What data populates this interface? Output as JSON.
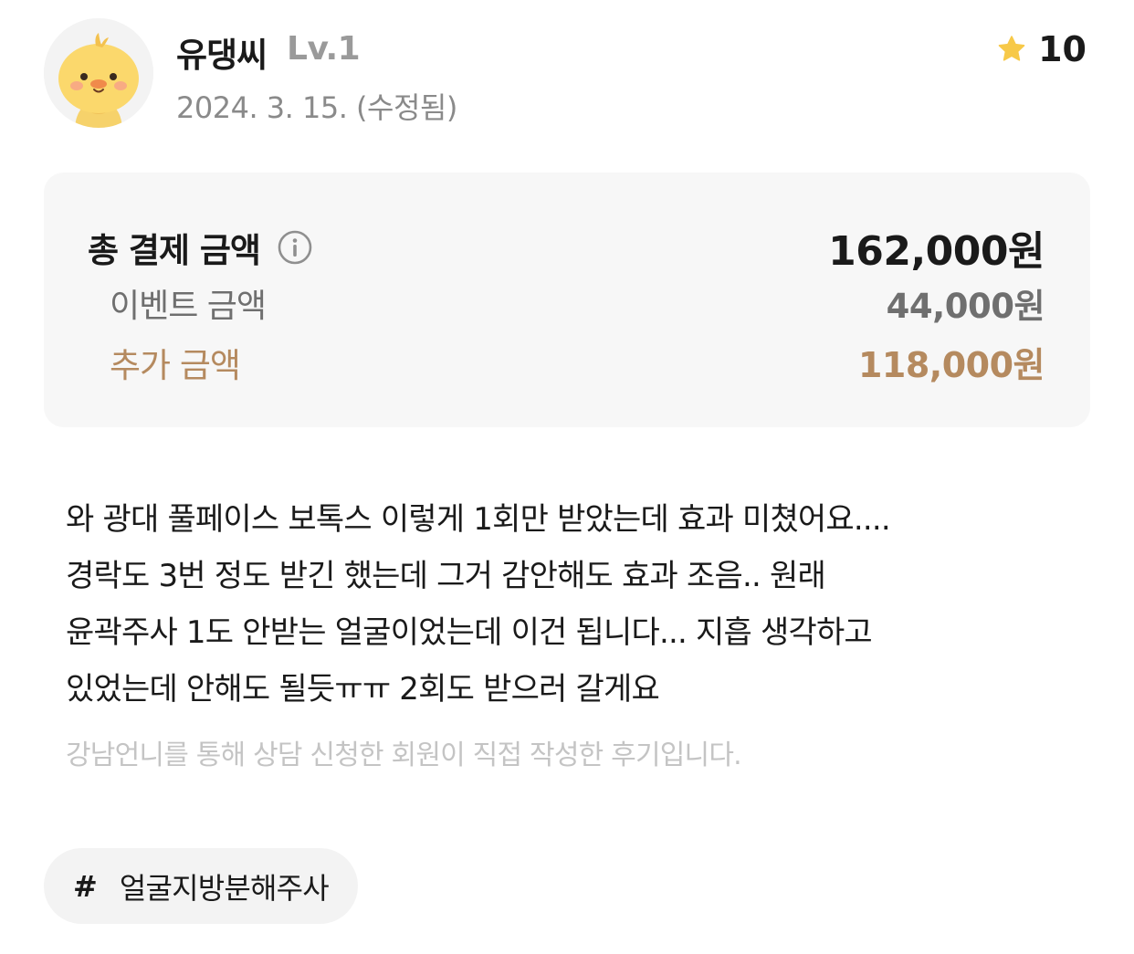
{
  "header": {
    "nickname": "유댕씨",
    "level": "Lv.1",
    "date": "2024. 3. 15. (수정됨)",
    "rating_icon": "star-icon",
    "rating_score": "10",
    "colors": {
      "star": "#f7c948"
    }
  },
  "price": {
    "total_label": "총 결제 금액",
    "total_info_icon": "info-icon",
    "total_value": "162,000원",
    "event_label": "이벤트 금액",
    "event_value": "44,000원",
    "extra_label": "추가 금액",
    "extra_value": "118,000원",
    "colors": {
      "extra": "#b58a5f"
    }
  },
  "review": {
    "lines": [
      "와 광대 풀페이스 보톡스 이렇게 1회만 받았는데 효과 미쳤어요....",
      "경락도 3번 정도 받긴 했는데 그거 감안해도 효과 조음.. 원래",
      "윤곽주사 1도 안받는 얼굴이었는데 이건 됩니다... 지흡 생각하고",
      "있었는데 안해도 될듯ㅠㅠ 2회도 받으러 갈게요"
    ],
    "disclaimer": "강남언니를 통해 상담 신청한 회원이 직접 작성한 후기입니다."
  },
  "tags": [
    {
      "hash": "#",
      "label": "얼굴지방분해주사"
    }
  ]
}
